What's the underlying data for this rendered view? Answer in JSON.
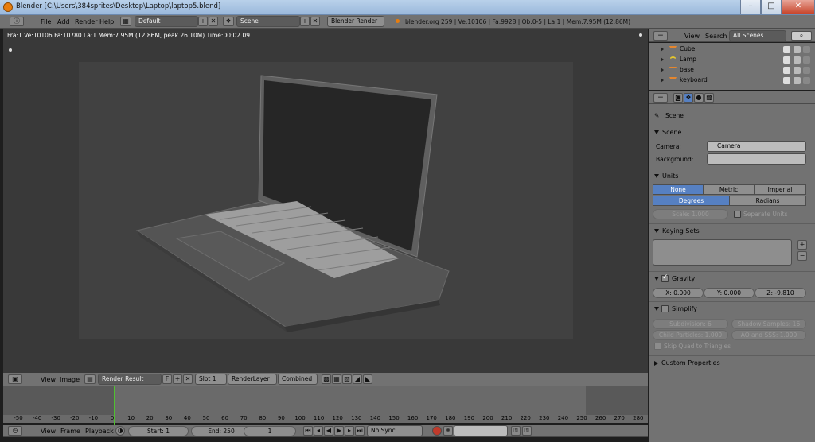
{
  "window": {
    "title": "Blender [C:\\Users\\384sprites\\Desktop\\Laptop\\laptop5.blend]",
    "controls": {
      "minimize": "–",
      "maximize": "□",
      "close": "✕"
    }
  },
  "info_header": {
    "menu": [
      "File",
      "Add",
      "Render",
      "Help"
    ],
    "screen_layout": "Default",
    "scene": "Scene",
    "render_engine": "Blender Render",
    "stats": "blender.org 259 | Ve:10106 | Fa:9928 | Ob:0-5 | La:1 | Mem:7.95M (12.86M)"
  },
  "viewport": {
    "info": "Fra:1  Ve:10106 Fa:10780 La:1 Mem:7.95M (12.86M, peak 26.10M) Time:00:02.09"
  },
  "image_editor_header": {
    "menu": [
      "View",
      "Image"
    ],
    "image": "Render Result",
    "fake_user": "F",
    "slot": "Slot 1",
    "layer": "RenderLayer",
    "pass": "Combined"
  },
  "timeline": {
    "ticks": [
      "-50",
      "-40",
      "-30",
      "-20",
      "-10",
      "0",
      "10",
      "20",
      "30",
      "40",
      "50",
      "60",
      "70",
      "80",
      "90",
      "100",
      "110",
      "120",
      "130",
      "140",
      "150",
      "160",
      "170",
      "180",
      "190",
      "200",
      "210",
      "220",
      "230",
      "240",
      "250",
      "260",
      "270",
      "280"
    ],
    "menu": [
      "View",
      "Frame",
      "Playback"
    ],
    "start": "Start: 1",
    "end": "End: 250",
    "current": "1",
    "sync": "No Sync"
  },
  "outliner": {
    "menu": [
      "View",
      "Search"
    ],
    "display": "All Scenes",
    "items": [
      {
        "name": "Cube"
      },
      {
        "name": "Lamp"
      },
      {
        "name": "base"
      },
      {
        "name": "keyboard"
      }
    ]
  },
  "properties": {
    "context": "Scene",
    "scene_panel": {
      "title": "Scene",
      "camera_label": "Camera:",
      "camera_value": "Camera",
      "background_label": "Background:"
    },
    "units_panel": {
      "title": "Units",
      "systems": [
        "None",
        "Metric",
        "Imperial"
      ],
      "rotation": [
        "Degrees",
        "Radians"
      ],
      "scale": "Scale: 1.000",
      "separate": "Separate Units"
    },
    "keying_panel": {
      "title": "Keying Sets"
    },
    "gravity_panel": {
      "title": "Gravity",
      "x": "X: 0.000",
      "y": "Y: 0.000",
      "z": "Z: -9.810"
    },
    "simplify_panel": {
      "title": "Simplify",
      "subdivision": "Subdivision: 6",
      "shadow_samples": "Shadow Samples: 16",
      "child_particles": "Child Particles: 1.000",
      "ao_sss": "AO and SSS: 1.000",
      "skip_quad": "Skip Quad to Triangles"
    },
    "custom_panel": {
      "title": "Custom Properties"
    }
  },
  "colors": {
    "accent": "#5680c2",
    "header": "#727272",
    "viewport": "#393939",
    "playhead": "#50c030"
  }
}
